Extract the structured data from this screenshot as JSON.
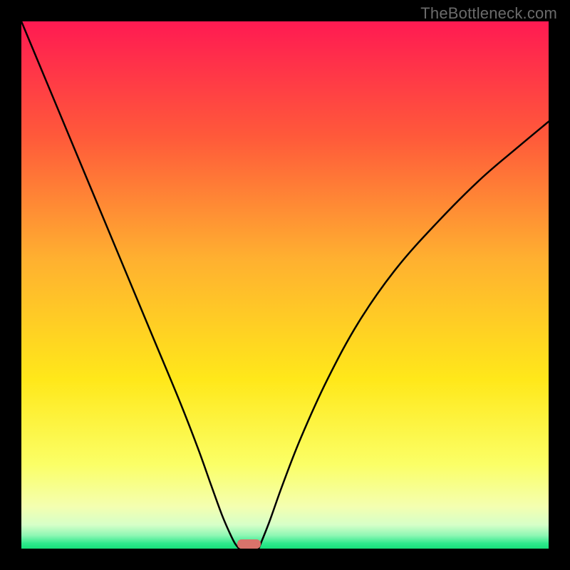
{
  "watermark": "TheBottleneck.com",
  "chart_data": {
    "type": "line",
    "title": "",
    "xlabel": "",
    "ylabel": "",
    "xlim": [
      0,
      1
    ],
    "ylim": [
      0,
      1
    ],
    "gradient_stops": [
      {
        "pos": 0.0,
        "color": "#ff1a52"
      },
      {
        "pos": 0.22,
        "color": "#ff5a3a"
      },
      {
        "pos": 0.45,
        "color": "#ffb030"
      },
      {
        "pos": 0.68,
        "color": "#ffe81a"
      },
      {
        "pos": 0.84,
        "color": "#fbff66"
      },
      {
        "pos": 0.92,
        "color": "#f4ffb0"
      },
      {
        "pos": 0.955,
        "color": "#d6ffc8"
      },
      {
        "pos": 0.975,
        "color": "#8ef7b4"
      },
      {
        "pos": 0.99,
        "color": "#2fe98c"
      },
      {
        "pos": 1.0,
        "color": "#17e07a"
      }
    ],
    "series": [
      {
        "name": "left-branch",
        "x": [
          0.0,
          0.05,
          0.1,
          0.15,
          0.2,
          0.25,
          0.3,
          0.335,
          0.36,
          0.38,
          0.395,
          0.405,
          0.413
        ],
        "y": [
          1.0,
          0.88,
          0.76,
          0.64,
          0.52,
          0.4,
          0.28,
          0.19,
          0.12,
          0.065,
          0.03,
          0.01,
          0.0
        ]
      },
      {
        "name": "right-branch",
        "x": [
          0.45,
          0.47,
          0.495,
          0.53,
          0.58,
          0.64,
          0.71,
          0.79,
          0.87,
          0.94,
          1.0
        ],
        "y": [
          0.0,
          0.05,
          0.12,
          0.21,
          0.32,
          0.43,
          0.53,
          0.62,
          0.7,
          0.76,
          0.81
        ]
      }
    ],
    "marker": {
      "x_center": 0.432,
      "width": 0.045,
      "height": 0.018,
      "color": "#d9736b"
    }
  }
}
